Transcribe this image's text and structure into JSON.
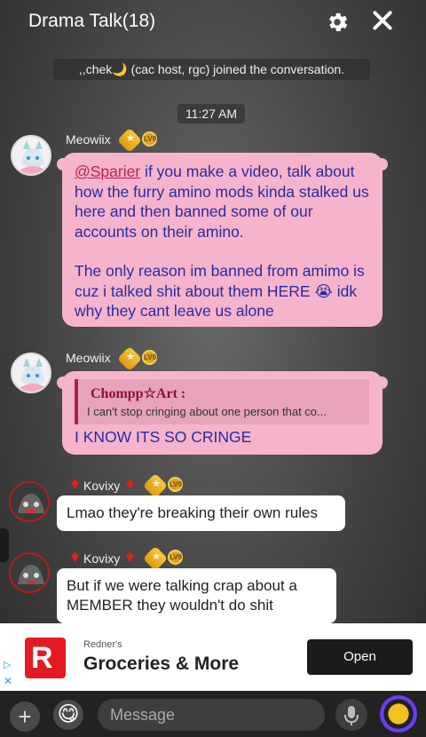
{
  "header": {
    "title": "Drama Talk(18)"
  },
  "system_message": ",,chek🌙 (cac host, rgc) joined the conversation.",
  "timestamp": "11:27 AM",
  "messages": [
    {
      "username": "Meowiix",
      "level": "LV9",
      "mention": "@Sparier",
      "text_after_mention": " if you make a video, talk about how the furry amino mods kinda stalked us here and then banned some of our accounts on their amino.",
      "text_2": "The only reason im banned from amimo is cuz i talked shit about them HERE 😭 idk why they cant leave us alone"
    },
    {
      "username": "Meowiix",
      "level": "LV9",
      "reply_author": "Chompp☆Art :",
      "reply_preview": "I can't stop cringing about one person that co...",
      "text": "I KNOW ITS SO CRINGE"
    },
    {
      "username": "Kovixy",
      "level": "LV9",
      "text": "Lmao they're breaking their own rules"
    },
    {
      "username": "Kovixy",
      "level": "LV9",
      "text": "But if we were talking crap about a MEMBER they wouldn't do shit"
    }
  ],
  "ad": {
    "logo_letter": "R",
    "brand": "Redner's",
    "headline": "Groceries & More",
    "cta": "Open"
  },
  "composer": {
    "placeholder": "Message",
    "plus": "+",
    "emoji": "😋"
  },
  "colors": {
    "bubble_pink": "#f5b4cc",
    "text_blue": "#2c2a9e",
    "mention_red": "#c21d52",
    "ad_red": "#e21b23"
  },
  "icons": [
    "gear-icon",
    "close-icon",
    "plus-icon",
    "emoji-icon",
    "mic-icon",
    "coin-icon",
    "adchoices-icon"
  ]
}
